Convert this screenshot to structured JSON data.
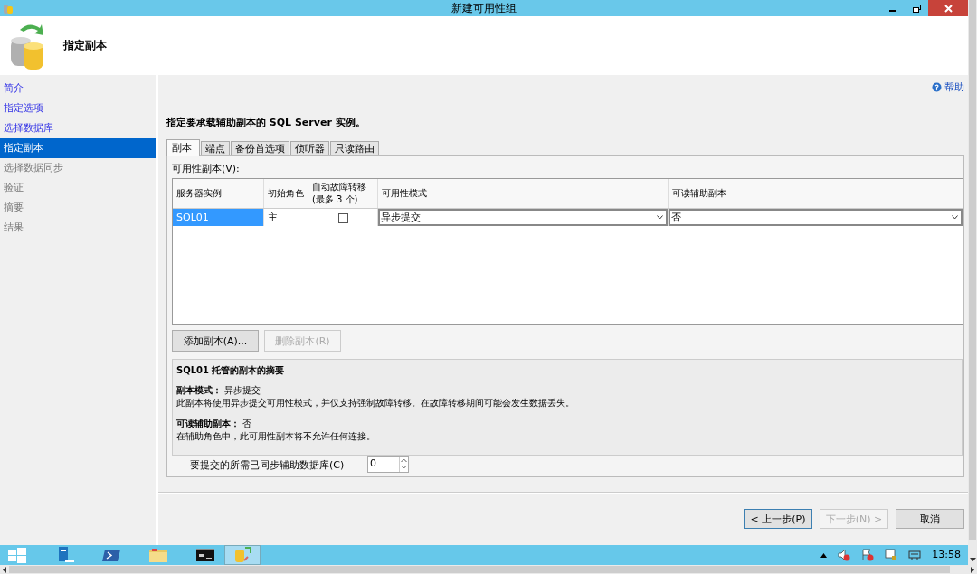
{
  "window": {
    "title": "新建可用性组"
  },
  "header": {
    "title": "指定副本"
  },
  "sidebar": {
    "items": [
      {
        "label": "简介",
        "selected": false,
        "disabled": false
      },
      {
        "label": "指定选项",
        "selected": false,
        "disabled": false
      },
      {
        "label": "选择数据库",
        "selected": false,
        "disabled": false
      },
      {
        "label": "指定副本",
        "selected": true,
        "disabled": false
      },
      {
        "label": "选择数据同步",
        "selected": false,
        "disabled": true
      },
      {
        "label": "验证",
        "selected": false,
        "disabled": true
      },
      {
        "label": "摘要",
        "selected": false,
        "disabled": true
      },
      {
        "label": "结果",
        "selected": false,
        "disabled": true
      }
    ]
  },
  "help": {
    "label": "帮助"
  },
  "instruction": "指定要承载辅助副本的 SQL Server 实例。",
  "tabs": [
    {
      "label": "副本",
      "selected": true
    },
    {
      "label": "端点",
      "selected": false
    },
    {
      "label": "备份首选项",
      "selected": false
    },
    {
      "label": "侦听器",
      "selected": false
    },
    {
      "label": "只读路由",
      "selected": false
    }
  ],
  "replicas": {
    "label": "可用性副本(V):",
    "columns": [
      "服务器实例",
      "初始角色",
      "自动故障转移(最多 3 个)",
      "可用性模式",
      "可读辅助副本"
    ],
    "rows": [
      {
        "server": "SQL01",
        "role": "主",
        "auto_failover": false,
        "mode": "异步提交",
        "readable": "否",
        "selected": true
      }
    ]
  },
  "replica_buttons": [
    {
      "label": "添加副本(A)...",
      "disabled": false
    },
    {
      "label": "删除副本(R)",
      "disabled": true
    }
  ],
  "summary": {
    "title": "SQL01 托管的副本的摘要",
    "sections": [
      {
        "heading": "**副本模式：** 异步提交",
        "text": "此副本将使用异步提交可用性模式，并仅支持强制故障转移。在故障转移期间可能会发生数据丢失。"
      },
      {
        "heading": "**可读辅助副本：** 否",
        "text": "在辅助角色中，此可用性副本将不允许任何连接。"
      }
    ]
  },
  "sync_count": {
    "label": "要提交的所需已同步辅助数据库(C)",
    "value": "0"
  },
  "buttons": [
    {
      "label": "< 上一步(P)",
      "disabled": false
    },
    {
      "label": "下一步(N) >",
      "disabled": true
    },
    {
      "label": "取消",
      "disabled": false
    }
  ],
  "taskbar": {
    "clock": "13:58"
  }
}
